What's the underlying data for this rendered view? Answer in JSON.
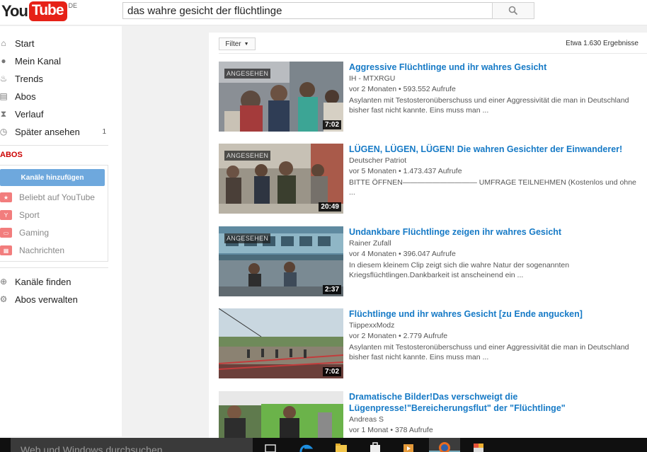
{
  "header": {
    "logo_you": "You",
    "logo_tube": "Tube",
    "logo_country": "DE",
    "search_value": "das wahre gesicht der flüchtlinge"
  },
  "sidebar": {
    "items": [
      {
        "label": "Start",
        "icon": "home-icon"
      },
      {
        "label": "Mein Kanal",
        "icon": "user-icon"
      },
      {
        "label": "Trends",
        "icon": "flame-icon"
      },
      {
        "label": "Abos",
        "icon": "subscriptions-icon"
      },
      {
        "label": "Verlauf",
        "icon": "history-icon"
      },
      {
        "label": "Später ansehen",
        "icon": "clock-icon",
        "count": "1"
      }
    ],
    "abos_title": "ABOS",
    "add_channels": "Kanäle hinzufügen",
    "channels": [
      {
        "label": "Beliebt auf YouTube",
        "icon": "popular-icon"
      },
      {
        "label": "Sport",
        "icon": "trophy-icon"
      },
      {
        "label": "Gaming",
        "icon": "gamepad-icon"
      },
      {
        "label": "Nachrichten",
        "icon": "news-icon"
      }
    ],
    "bottom": [
      {
        "label": "Kanäle finden",
        "icon": "plus-circle-icon"
      },
      {
        "label": "Abos verwalten",
        "icon": "gear-icon"
      }
    ]
  },
  "results_header": {
    "filter_label": "Filter",
    "count_text": "Etwa 1.630 Ergebnisse"
  },
  "results": [
    {
      "title": "Aggressive Flüchtlinge und ihr wahres Gesicht",
      "channel": "IH - MTXRGU",
      "age": "vor 2 Monaten",
      "views": "593.552 Aufrufe",
      "desc": "Asylanten mit Testosteronüberschuss und einer Aggressivität die man in Deutschland bisher fast nicht kannte. Eins muss man ...",
      "seen": "ANGESEHEN",
      "duration": "7:02"
    },
    {
      "title": "LÜGEN, LÜGEN, LÜGEN! Die wahren Gesichter der Einwanderer!",
      "channel": "Deutscher Patriot",
      "age": "vor 5 Monaten",
      "views": "1.473.437 Aufrufe",
      "desc": "BITTE ÖFFNEN—————————— UMFRAGE TEILNEHMEN (Kostenlos und ohne ...",
      "seen": "ANGESEHEN",
      "duration": "20:49"
    },
    {
      "title": "Undankbare Flüchtlinge zeigen ihr wahres Gesicht",
      "channel": "Rainer Zufall",
      "age": "vor 4 Monaten",
      "views": "396.047 Aufrufe",
      "desc": "In diesem kleinem Clip zeigt sich die wahre Natur der sogenannten Kriegsflüchtlingen.Dankbarkeit ist anscheinend ein ...",
      "seen": "ANGESEHEN",
      "duration": "2:37"
    },
    {
      "title": "Flüchtlinge und ihr wahres Gesicht [zu Ende angucken]",
      "channel": "TiippexxModz",
      "age": "vor 2 Monaten",
      "views": "2.779 Aufrufe",
      "desc": "Asylanten mit Testosteronüberschuss und einer Aggressivität die man in Deutschland bisher fast nicht kannte. Eins muss man ...",
      "seen": "",
      "duration": "7:02"
    },
    {
      "title": "Dramatische Bilder!Das verschweigt die Lügenpresse!\"Bereicherungsflut\" der \"Flüchtlinge\"",
      "channel": "Andreas S",
      "age": "vor 1 Monat",
      "views": "378 Aufrufe",
      "desc": "",
      "seen": "",
      "duration": ""
    }
  ],
  "taskbar": {
    "search_placeholder": "Web und Windows durchsuchen"
  }
}
